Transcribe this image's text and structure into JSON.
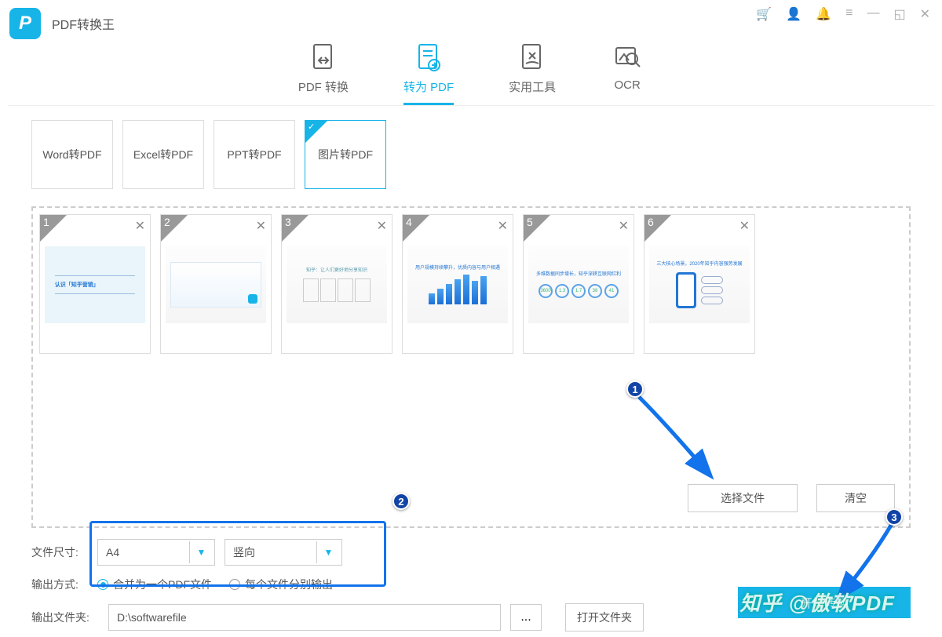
{
  "app": {
    "title": "PDF转换王"
  },
  "mainTabs": [
    {
      "label": "PDF 转换"
    },
    {
      "label": "转为 PDF"
    },
    {
      "label": "实用工具"
    },
    {
      "label": "OCR"
    }
  ],
  "subTabs": [
    {
      "label": "Word转PDF"
    },
    {
      "label": "Excel转PDF"
    },
    {
      "label": "PPT转PDF"
    },
    {
      "label": "图片转PDF"
    }
  ],
  "thumbs": [
    {
      "n": "1"
    },
    {
      "n": "2"
    },
    {
      "n": "3"
    },
    {
      "n": "4"
    },
    {
      "n": "5"
    },
    {
      "n": "6"
    }
  ],
  "buttons": {
    "selectFile": "选择文件",
    "clear": "清空",
    "openFolder": "打开文件夹",
    "browse": "...",
    "convert": "开始转换"
  },
  "labels": {
    "fileSize": "文件尺寸:",
    "outputMode": "输出方式:",
    "outputFolder": "输出文件夹:"
  },
  "sizeSelect": {
    "value": "A4"
  },
  "orientSelect": {
    "value": "竖向"
  },
  "radios": {
    "merge": "合并为一个PDF文件",
    "separate": "每个文件分别输出"
  },
  "outputPath": "D:\\softwarefile",
  "callouts": {
    "c1": "1",
    "c2": "2",
    "c3": "3"
  },
  "watermark": "知乎 @傲软PDF",
  "preview": {
    "t1": "认识「知乎营销」"
  }
}
